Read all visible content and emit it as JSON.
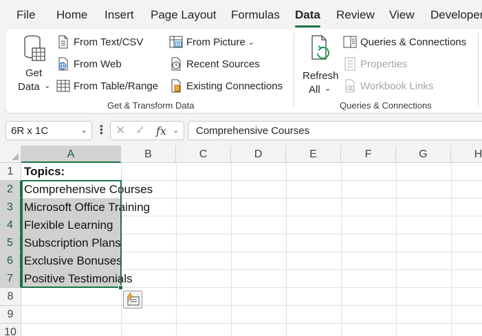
{
  "tabs": [
    "File",
    "Home",
    "Insert",
    "Page Layout",
    "Formulas",
    "Data",
    "Review",
    "View",
    "Developer"
  ],
  "active_tab": "Data",
  "ribbon": {
    "get_data_line1": "Get",
    "get_data_line2": "Data",
    "from_text_csv": "From Text/CSV",
    "from_web": "From Web",
    "from_table_range": "From Table/Range",
    "from_picture": "From Picture",
    "recent_sources": "Recent Sources",
    "existing_connections": "Existing Connections",
    "group1_label": "Get & Transform Data",
    "refresh_line1": "Refresh",
    "refresh_line2": "All",
    "queries_connections": "Queries & Connections",
    "properties": "Properties",
    "workbook_links": "Workbook Links",
    "group2_label": "Queries & Connections"
  },
  "namebox": {
    "value": "6R x 1C"
  },
  "formula_bar": {
    "value": "Comprehensive Courses"
  },
  "columns": [
    "A",
    "B",
    "C",
    "D",
    "E",
    "F",
    "G",
    "H"
  ],
  "rows": [
    "1",
    "2",
    "3",
    "4",
    "5",
    "6",
    "7",
    "8",
    "9",
    "10"
  ],
  "cells": {
    "A1": "Topics:",
    "A2": "Comprehensive Courses",
    "A3": "Microsoft Office Training",
    "A4": "Flexible Learning",
    "A5": "Subscription Plans",
    "A6": "Exclusive Bonuses",
    "A7": "Positive Testimonials"
  },
  "colors": {
    "accent": "#1a7343",
    "selection": "#d0d0d0"
  }
}
